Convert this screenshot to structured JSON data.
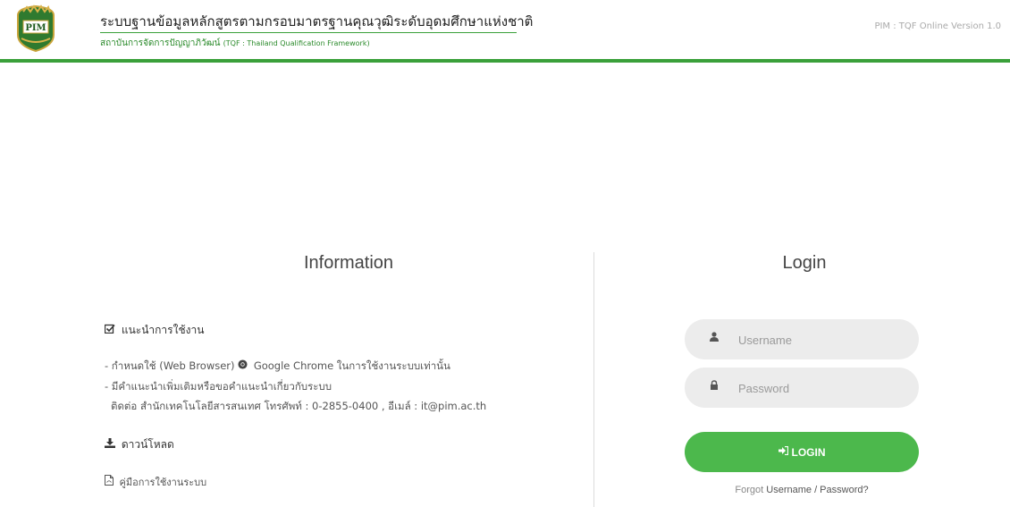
{
  "header": {
    "logo_text": "PIM",
    "title": "ระบบฐานข้อมูลหลักสูตรตามกรอบมาตรฐานคุณวุฒิระดับอุดมศึกษาแห่งชาติ",
    "subtitle_th": "สถาบันการจัดการปัญญาภิวัฒน์",
    "subtitle_en": "(TQF : Thailand Qualification Framework)",
    "version": "PIM : TQF Online Version 1.0"
  },
  "info": {
    "heading": "Information",
    "guide_title": "แนะนำการใช้งาน",
    "guide_lines": [
      "- กำหนดใช้ (Web Browser) ",
      "Google Chrome ในการใช้งานระบบเท่านั้น",
      "- มีคำแนะนำเพิ่มเติมหรือขอคำแนะนำเกี่ยวกับระบบ",
      "ติดต่อ สำนักเทคโนโลยีสารสนเทศ โทรศัพท์ : 0-2855-0400 , อีเมล์ : it@pim.ac.th"
    ],
    "download_title": "ดาวน์โหลด",
    "manual_link": "คู่มือการใช้งานระบบ"
  },
  "login": {
    "heading": "Login",
    "username_placeholder": "Username",
    "password_placeholder": "Password",
    "button_label": "LOGIN",
    "forgot_prefix": "Forgot ",
    "forgot_link": "Username / Password?"
  },
  "colors": {
    "accent_green": "#4cb84c",
    "header_line": "#3aa03a"
  },
  "icons": {
    "check": "check-square-icon",
    "chrome": "chrome-icon",
    "download": "download-icon",
    "pdf": "pdf-file-icon",
    "user": "user-icon",
    "lock": "lock-icon",
    "signin": "sign-in-icon"
  }
}
